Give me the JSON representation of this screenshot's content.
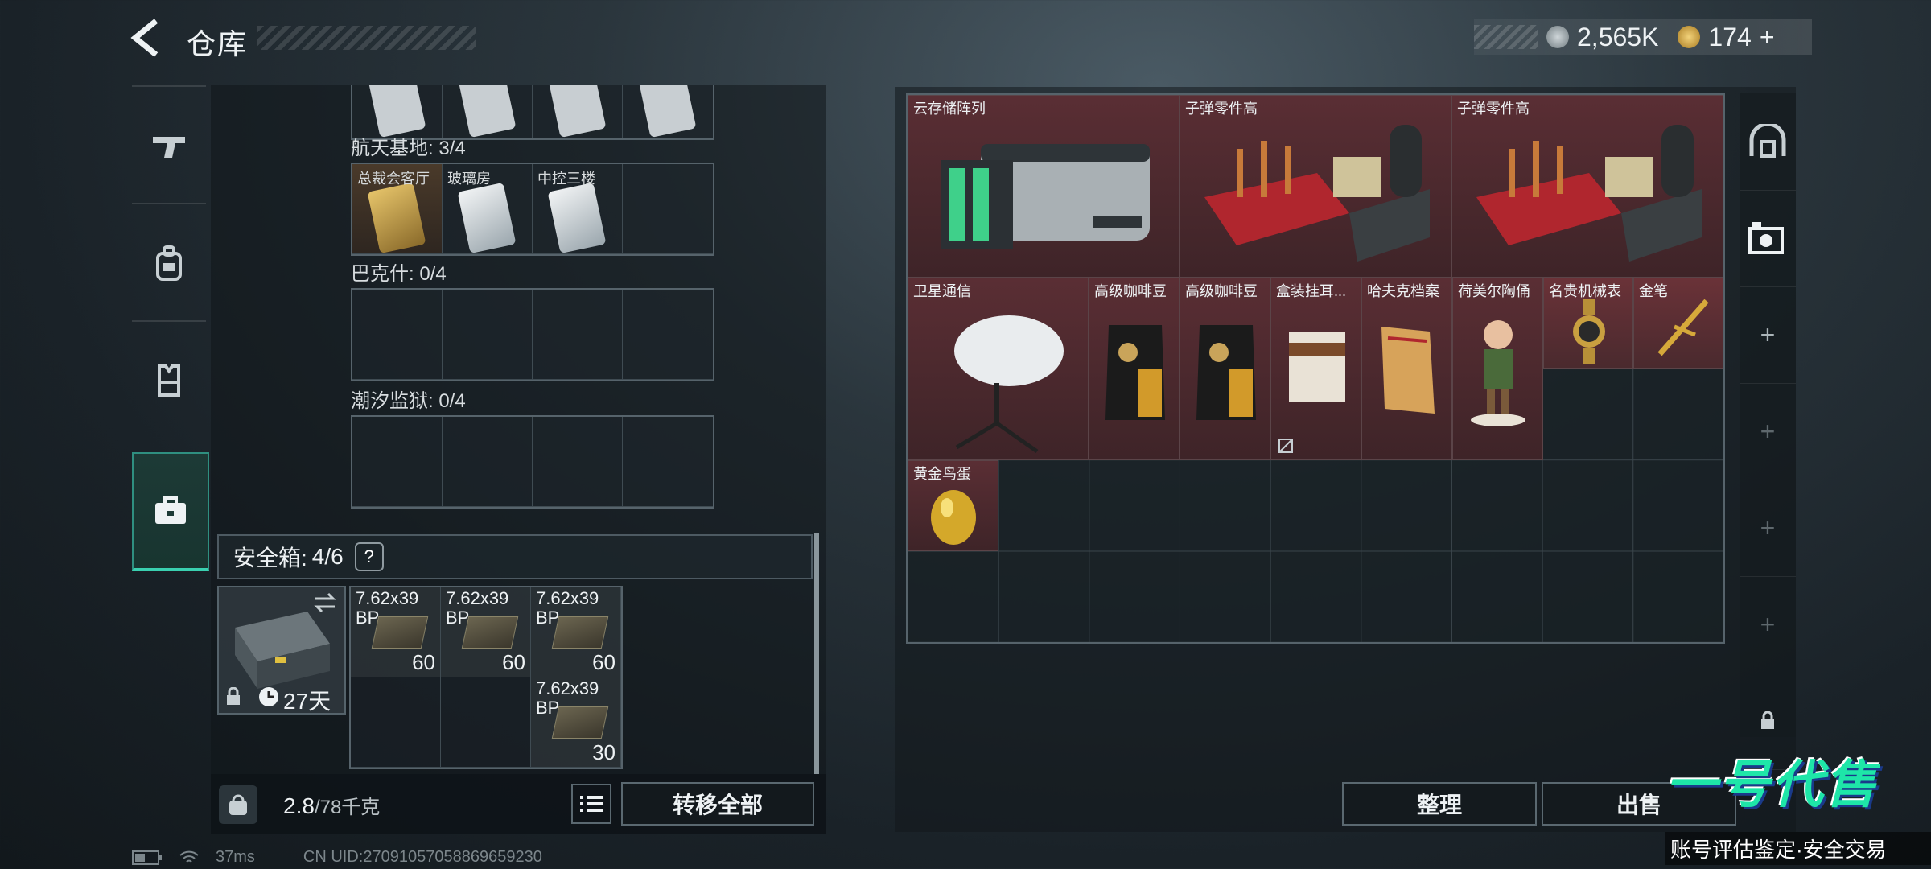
{
  "header": {
    "title": "仓库",
    "currency_1": "2,565K",
    "currency_2": "174",
    "currency_add": "+"
  },
  "left_tabs": [
    {
      "name": "weapon-tab",
      "icon": "gun-icon"
    },
    {
      "name": "gear-tab",
      "icon": "backpack-icon"
    },
    {
      "name": "armor-tab",
      "icon": "vest-icon"
    },
    {
      "name": "safebox-tab",
      "icon": "briefcase-icon",
      "active": true
    }
  ],
  "key_sections": [
    {
      "label": "航天基地: 3/4",
      "items": [
        "总裁会客厅",
        "玻璃房",
        "中控三楼",
        ""
      ]
    },
    {
      "label": "巴克什: 0/4",
      "items": [
        "",
        "",
        "",
        ""
      ]
    },
    {
      "label": "潮汐监狱: 0/4",
      "items": [
        "",
        "",
        "",
        ""
      ]
    }
  ],
  "safebox": {
    "label": "安全箱:",
    "count": "4/6",
    "help": "?",
    "duration": "27天",
    "ammo": [
      {
        "name": "7.62x39 BP",
        "count": "60"
      },
      {
        "name": "7.62x39 BP",
        "count": "60"
      },
      {
        "name": "7.62x39 BP",
        "count": "60"
      },
      {
        "name": "7.62x39 BP",
        "count": "30"
      }
    ]
  },
  "footer_left": {
    "kg_icon": "KG",
    "weight": "2.8",
    "weight_max": "/78千克",
    "transfer_all": "转移全部"
  },
  "stash_items": [
    {
      "label": "云存储阵列",
      "icon": "server-array-icon"
    },
    {
      "label": "子弹零件高",
      "icon": "ammo-parts-icon"
    },
    {
      "label": "子弹零件高",
      "icon": "ammo-parts-icon"
    },
    {
      "label": "卫星通信",
      "icon": "satellite-dish-icon"
    },
    {
      "label": "高级咖啡豆",
      "icon": "coffee-bag-icon"
    },
    {
      "label": "高级咖啡豆",
      "icon": "coffee-bag-icon"
    },
    {
      "label": "盒装挂耳...",
      "icon": "coffee-box-icon"
    },
    {
      "label": "哈夫克档案",
      "icon": "file-folder-icon"
    },
    {
      "label": "荷美尔陶俑",
      "icon": "figurine-icon"
    },
    {
      "label": "名贵机械表",
      "icon": "watch-icon"
    },
    {
      "label": "金笔",
      "icon": "gold-pen-icon"
    },
    {
      "label": "黄金鸟蛋",
      "icon": "golden-egg-icon"
    }
  ],
  "footer_right": {
    "sort": "整理",
    "sell": "出售"
  },
  "status_bar": {
    "ping": "37ms",
    "uid": "CN UID:2709105705886965923​0"
  },
  "watermark": {
    "brand": "一号代售",
    "slogan": "账号评估鉴定·安全交易"
  }
}
